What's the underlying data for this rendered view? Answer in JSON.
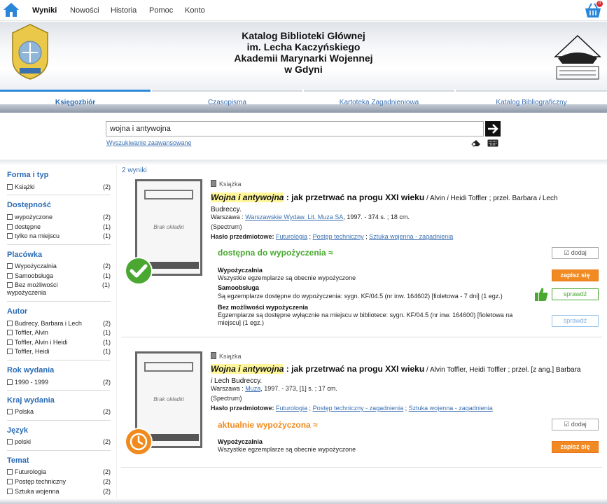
{
  "topnav": {
    "links": [
      "Wyniki",
      "Nowości",
      "Historia",
      "Pomoc",
      "Konto"
    ],
    "cart_count": "0"
  },
  "header": {
    "title_lines": [
      "Katalog Biblioteki Głównej",
      "im. Lecha Kaczyńskiego",
      "Akademii Marynarki Wojennej",
      "w Gdyni"
    ]
  },
  "tabs": [
    "Księgozbiór",
    "Czasopisma",
    "Kartoteka Zagadnieniowa",
    "Katalog Bibliograficzny"
  ],
  "search": {
    "value": "wojna i antywojna",
    "advanced_label": "Wyszukiwanie zaawansowane"
  },
  "facets": [
    {
      "title": "Forma i typ",
      "items": [
        {
          "label": "Książki",
          "count": "(2)"
        }
      ]
    },
    {
      "title": "Dostępność",
      "items": [
        {
          "label": "wypożyczone",
          "count": "(2)"
        },
        {
          "label": "dostępne",
          "count": "(1)"
        },
        {
          "label": "tylko na miejscu",
          "count": "(1)"
        }
      ]
    },
    {
      "title": "Placówka",
      "items": [
        {
          "label": "Wypożyczalnia",
          "count": "(2)"
        },
        {
          "label": "Samoobsługa",
          "count": "(1)"
        },
        {
          "label": "Bez możliwości wypożyczenia",
          "count": "(1)"
        }
      ]
    },
    {
      "title": "Autor",
      "items": [
        {
          "label": "Budrecy, Barbara i Lech",
          "count": "(2)"
        },
        {
          "label": "Toffler, Alvin",
          "count": "(1)"
        },
        {
          "label": "Toffler, Alvin i Heidi",
          "count": "(1)"
        },
        {
          "label": "Toffler, Heidi",
          "count": "(1)"
        }
      ]
    },
    {
      "title": "Rok wydania",
      "items": [
        {
          "label": "1990 - 1999",
          "count": "(2)"
        }
      ]
    },
    {
      "title": "Kraj wydania",
      "items": [
        {
          "label": "Polska",
          "count": "(2)"
        }
      ]
    },
    {
      "title": "Język",
      "items": [
        {
          "label": "polski",
          "count": "(2)"
        }
      ]
    },
    {
      "title": "Temat",
      "items": [
        {
          "label": "Futurologia",
          "count": "(2)"
        },
        {
          "label": "Postęp techniczny",
          "count": "(2)"
        },
        {
          "label": "Sztuka wojenna",
          "count": "(2)"
        }
      ]
    }
  ],
  "results_count": "2 wyniki",
  "records": [
    {
      "type": "Książka",
      "no_cover": "Brak okładki",
      "title_hl": "Wojna i antywojna",
      "title_rest": " : jak przetrwać na progu XXI wieku",
      "resp_pre": " / Alvin ",
      "resp_i": "i",
      "resp_post": " Heidi Toffler ; przeł. Barbara ",
      "resp_i2": "i",
      "resp_post2": " Lech Budreccy.",
      "place": "Warszawa : ",
      "publisher": "Warszawskie Wydaw. Lit. Muza SA",
      "pub_tail": ", 1997. - 374 s. ; 18 cm.",
      "series": "(Spectrum)",
      "subjects_label": "Hasło przedmiotowe: ",
      "subjects": [
        "Futurologia",
        "Postęp techniczny",
        "Sztuka wojenna - zagadnienia"
      ],
      "availability": "dostępna do wypożyczenia ≈",
      "add_label": "dodaj",
      "locations": [
        {
          "name": "Wypożyczalnia",
          "desc": "Wszystkie egzemplarze są obecnie wypożyczone",
          "button": "zapisz się"
        },
        {
          "name": "Samoobsługa",
          "desc": "Są egzemplarze dostępne do wypożyczenia: sygn. KF/04.5 (nr inw. 164602) [fioletowa - 7 dni] (1 egz.)",
          "button": "sprawdź"
        },
        {
          "name": "Bez możliwości wypożyczenia",
          "desc": "Egzemplarze są dostępne wyłącznie na miejscu w bibliotece: sygn. KF/04.5 (nr inw. 164600) [fioletowa na miejscu] (1 egz.)",
          "button": "sprawdź"
        }
      ]
    },
    {
      "type": "Książka",
      "no_cover": "Brak okładki",
      "title_hl": "Wojna i antywojna",
      "title_rest": " : jak przetrwać na progu XXI wieku",
      "resp_pre": " / Alvin Toffler, Heidi Toffler ; przeł. [z ang.] Barbara ",
      "resp_i": "i",
      "resp_post": " Lech Budreccy.",
      "place": "Warszawa : ",
      "publisher": "Muza",
      "pub_tail": ", 1997. - 373, [1] s. ; 17 cm.",
      "series": "(Spectrum)",
      "subjects_label": "Hasło przedmiotowe: ",
      "subjects": [
        "Futurologia",
        "Postęp techniczny - zagadnienia",
        "Sztuka wojenna - zagadnienia"
      ],
      "availability": "aktualnie wypożyczona ≈",
      "add_label": "dodaj",
      "locations": [
        {
          "name": "Wypożyczalnia",
          "desc": "Wszystkie egzemplarze są obecnie wypożyczone",
          "button": "zapisz się"
        }
      ]
    }
  ],
  "colors": {
    "accent_blue": "#2a6bb4",
    "available_green": "#4aa832",
    "loaned_orange": "#f08a1c",
    "highlight": "#fff79a"
  }
}
